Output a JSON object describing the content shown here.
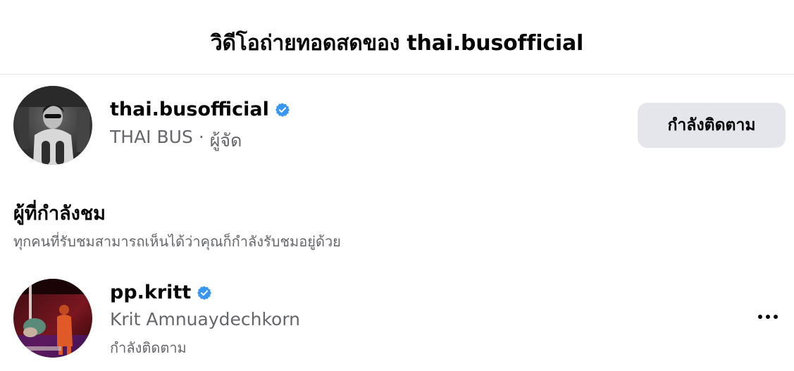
{
  "header": {
    "title": "วิดีโอถ่ายทอดสดของ thai.busofficial"
  },
  "host": {
    "username": "thai.busofficial",
    "verified": true,
    "page_name": "THAI BUS",
    "separator": "·",
    "role": "ผู้จัด",
    "follow_button_label": "กำลังติดตาม"
  },
  "viewers_section": {
    "title": "ผู้ที่กำลังชม",
    "subtitle": "ทุกคนที่รับชมสามารถเห็นได้ว่าคุณก็กำลังรับชมอยู่ด้วย",
    "viewers": [
      {
        "username": "pp.kritt",
        "verified": true,
        "full_name": "Krit Amnuaydechkorn",
        "status": "กำลังติดตาม"
      }
    ]
  },
  "colors": {
    "verified_badge": "#3897f0",
    "button_bg": "#e4e6eb",
    "secondary_text": "#65676b",
    "primary_text": "#050505"
  },
  "icons": {
    "verified": "verified-badge-icon",
    "more": "more-options-icon"
  }
}
